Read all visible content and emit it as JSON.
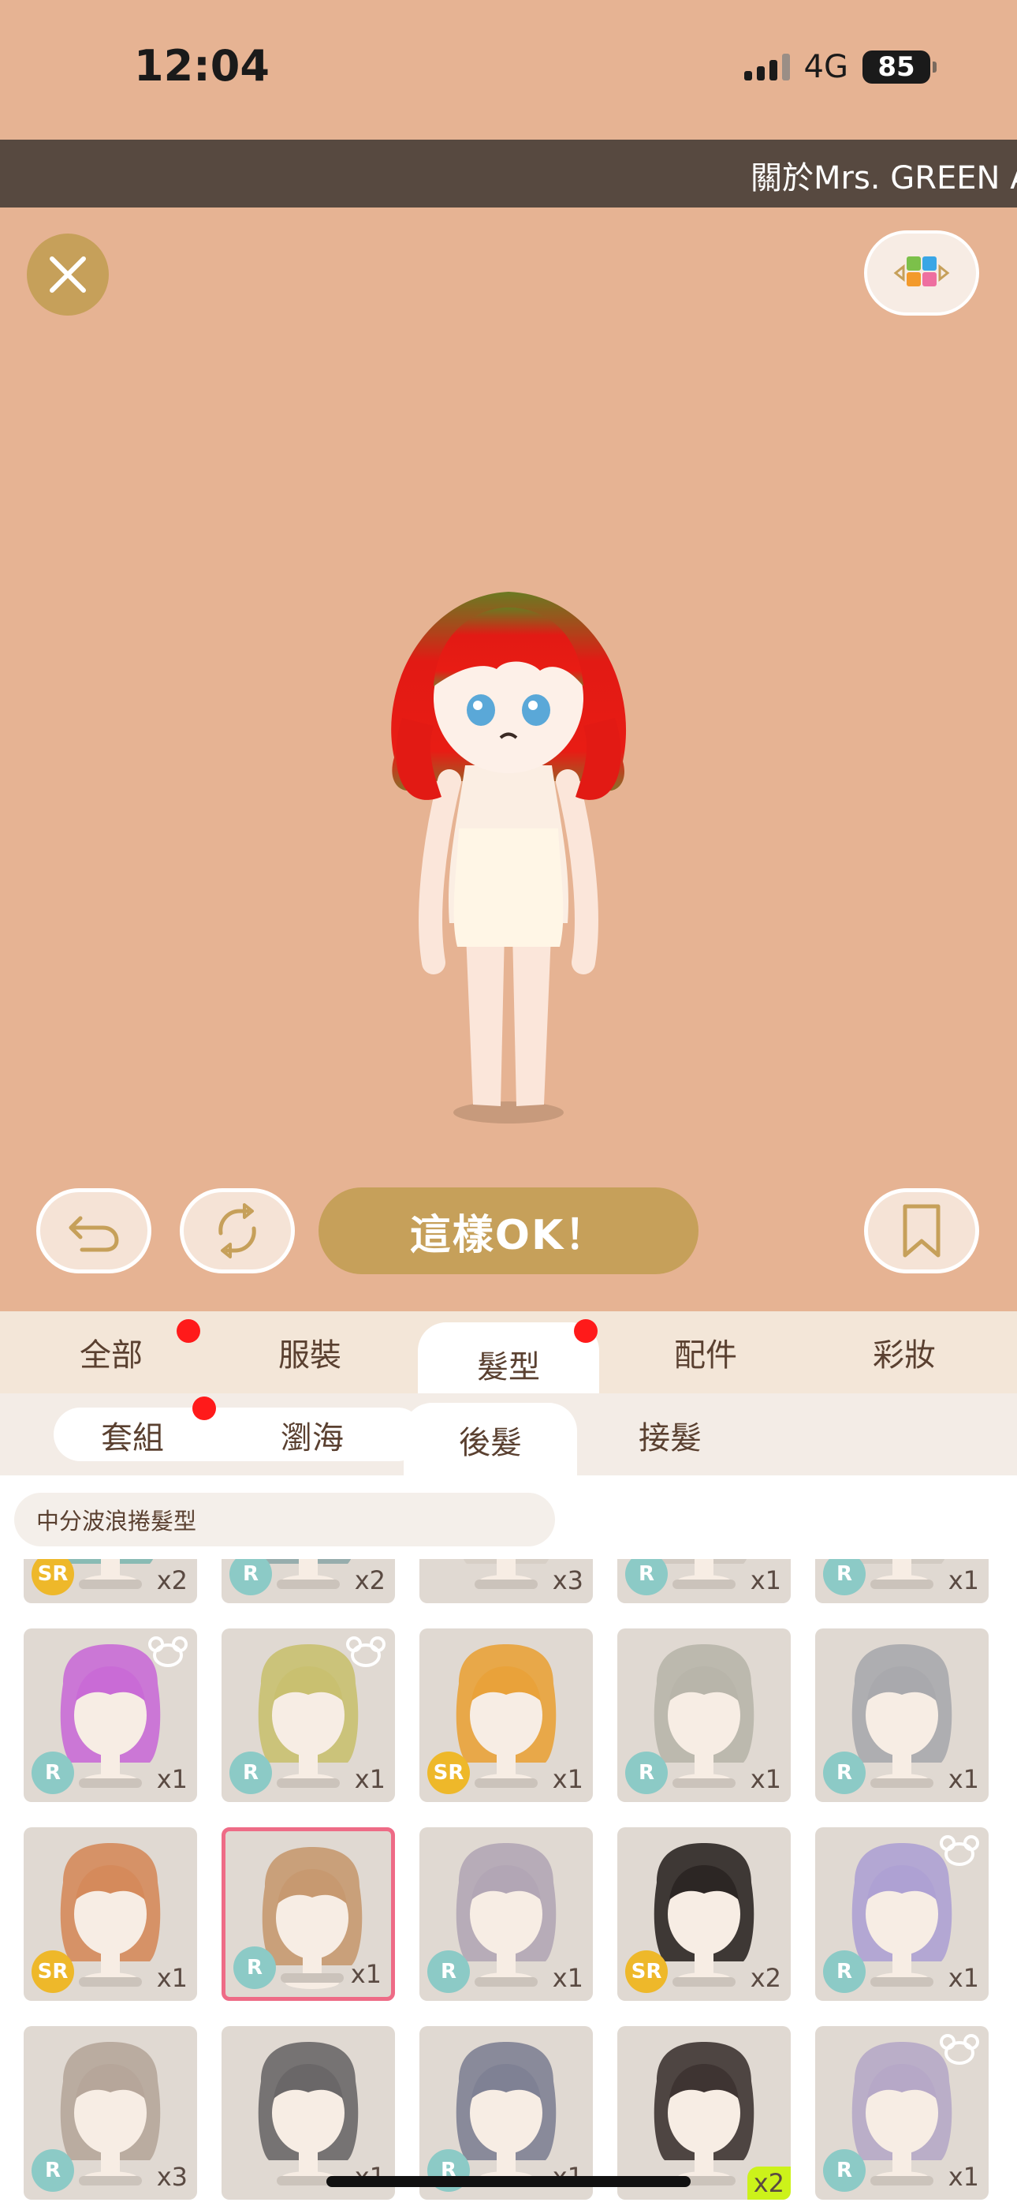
{
  "status_bar": {
    "time": "12:04",
    "network": "4G",
    "battery": "85"
  },
  "banner": {
    "text": "關於Mrs. GREEN A"
  },
  "icons": {
    "close": "close-icon",
    "palette": "grid-arrows-icon",
    "undo": "undo-icon",
    "refresh": "refresh-icon",
    "bookmark": "bookmark-icon"
  },
  "actions": {
    "ok_label": "這樣OK！"
  },
  "main_tabs": [
    {
      "label": "全部",
      "dot": true
    },
    {
      "label": "服裝",
      "dot": false
    },
    {
      "label": "髮型",
      "dot": true,
      "active": true
    },
    {
      "label": "配件",
      "dot": false
    },
    {
      "label": "彩妝",
      "dot": false
    }
  ],
  "sub_tabs": [
    {
      "label": "套組",
      "dot": true
    },
    {
      "label": "瀏海",
      "dot": false
    },
    {
      "label": "後髮",
      "active": true
    },
    {
      "label": "接髮"
    }
  ],
  "selected_item_name": "中分波浪捲髮型",
  "items": [
    {
      "rarity": "SR",
      "qty": "x2",
      "hair": "#7fb7b0",
      "partial": true
    },
    {
      "rarity": "R",
      "qty": "x2",
      "hair": "#8fa7a8",
      "partial": true
    },
    {
      "rarity": "",
      "qty": "x3",
      "hair": "#d6cdc4",
      "partial": true
    },
    {
      "rarity": "R",
      "qty": "x1",
      "hair": "#cfc7bf",
      "partial": true
    },
    {
      "rarity": "R",
      "qty": "x1",
      "hair": "#d0c9c1",
      "partial": true
    },
    {
      "rarity": "R",
      "qty": "x1",
      "hair": "#c96bd6",
      "bear": true
    },
    {
      "rarity": "R",
      "qty": "x1",
      "hair": "#c9c070",
      "bear": true
    },
    {
      "rarity": "SR",
      "qty": "x1",
      "hair": "#e9a23a"
    },
    {
      "rarity": "R",
      "qty": "x1",
      "hair": "#b8b5aa"
    },
    {
      "rarity": "R",
      "qty": "x1",
      "hair": "#a9a9ad"
    },
    {
      "rarity": "SR",
      "qty": "x1",
      "hair": "#d58a5b"
    },
    {
      "rarity": "R",
      "qty": "x1",
      "hair": "#c79970",
      "selected": true
    },
    {
      "rarity": "R",
      "qty": "x1",
      "hair": "#b2a6b5"
    },
    {
      "rarity": "SR",
      "qty": "x2",
      "hair": "#2c2624"
    },
    {
      "rarity": "R",
      "qty": "x1",
      "hair": "#aea1d3",
      "bear": true
    },
    {
      "rarity": "R",
      "qty": "x3",
      "hair": "#b6a69a"
    },
    {
      "rarity": "",
      "qty": "x1",
      "hair": "#6a6768"
    },
    {
      "rarity": "R",
      "qty": "x1",
      "hair": "#7f8194"
    },
    {
      "rarity": "",
      "qty": "x2",
      "hair": "#3e3432",
      "qty_highlight": true
    },
    {
      "rarity": "R",
      "qty": "x1",
      "hair": "#b6a8c7",
      "bear": true
    }
  ]
}
